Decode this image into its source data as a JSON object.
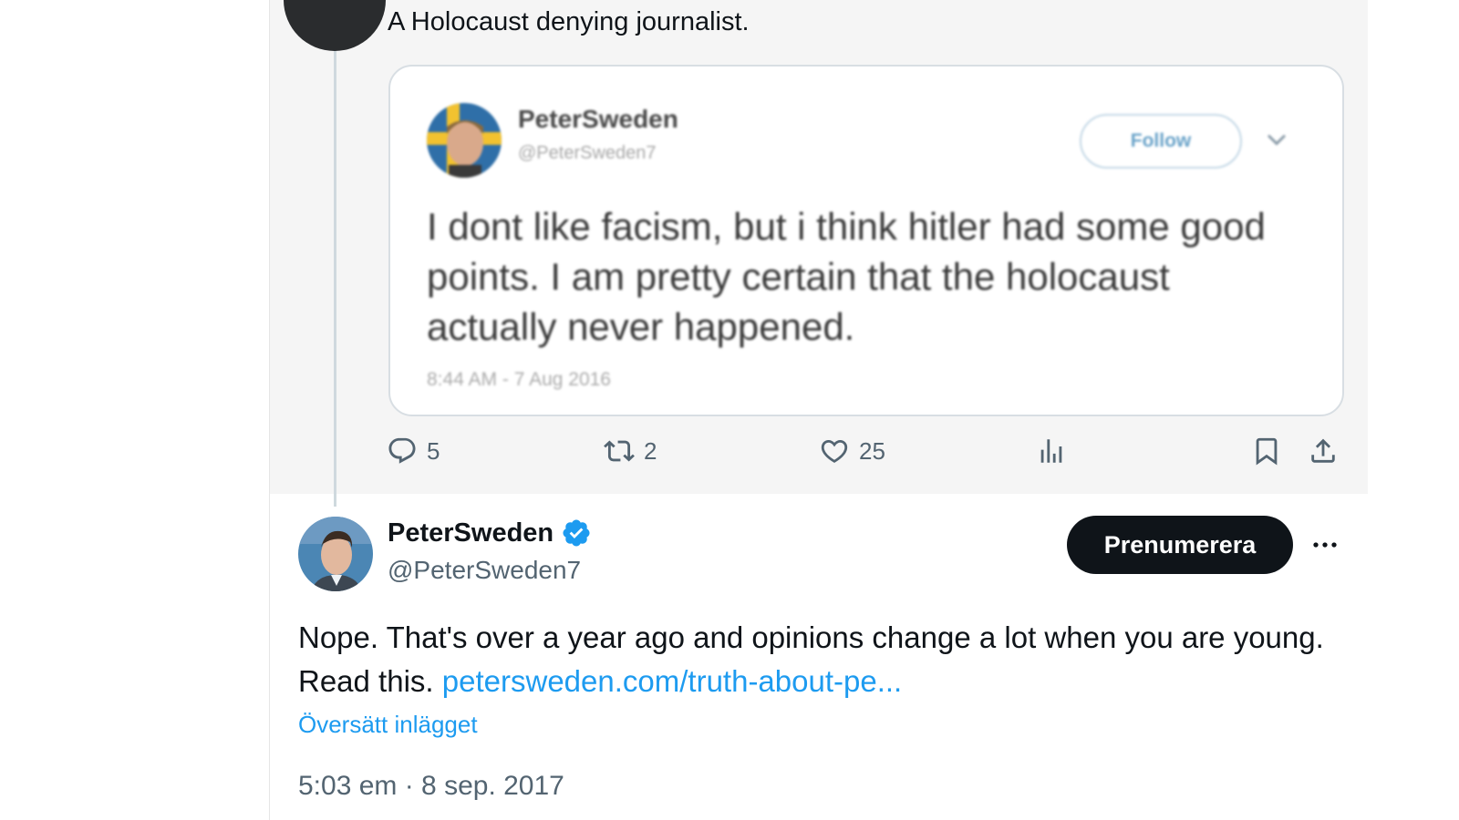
{
  "parent_post": {
    "text": "A Holocaust denying journalist."
  },
  "embedded_image": {
    "name": "PeterSweden",
    "handle": "@PeterSweden7",
    "follow_label": "Follow",
    "text": "I dont like facism, but i think hitler had some good points. I am pretty certain that the holocaust actually never happened.",
    "date": "8:44 AM - 7 Aug 2016"
  },
  "actions": {
    "replies": "5",
    "reposts": "2",
    "likes": "25"
  },
  "reply_post": {
    "name": "PeterSweden",
    "handle": "@PeterSweden7",
    "subscribe_label": "Prenumerera",
    "text": "Nope. That's over a year ago and opinions change a lot when you are young. Read this.",
    "link": "petersweden.com/truth-about-pe...",
    "translate_label": "Översätt inlägget",
    "timestamp": "5:03 em · 8 sep. 2017"
  },
  "icons": {
    "reply": "reply-icon",
    "repost": "repost-icon",
    "like": "heart-icon",
    "views": "analytics-icon",
    "bookmark": "bookmark-icon",
    "share": "share-icon",
    "verified": "verified-badge-icon",
    "more": "more-icon",
    "chevron": "chevron-down-icon"
  },
  "colors": {
    "accent": "#1d9bf0",
    "text": "#0f1419",
    "muted": "#536471",
    "parent_background": "#f5f5f5"
  }
}
